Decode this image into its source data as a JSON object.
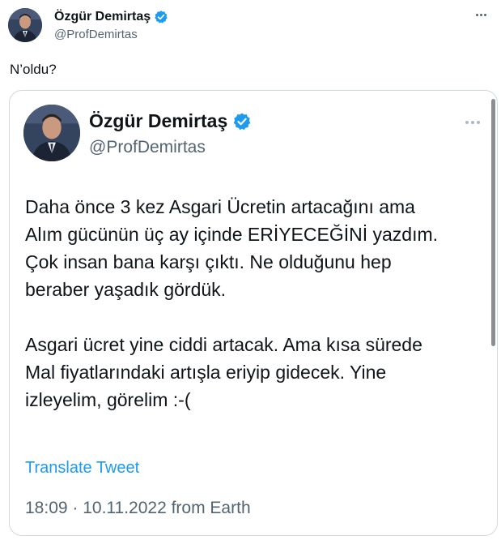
{
  "outer_tweet": {
    "author_name": "Özgür Demirtaş",
    "author_handle": "@ProfDemirtas",
    "text": "N’oldu?"
  },
  "quoted_tweet": {
    "author_name": "Özgür Demirtaş",
    "author_handle": "@ProfDemirtas",
    "paragraphs": [
      [
        "Daha önce 3 kez Asgari Ücretin artacağını ama",
        "Alım gücünün üç ay içinde ERİYECEĞİNİ yazdım.",
        "Çok insan bana karşı çıktı. Ne olduğunu hep",
        "beraber yaşadık gördük."
      ],
      [
        "Asgari ücret yine ciddi artacak. Ama kısa sürede",
        "Mal fiyatlarındaki artışla eriyip gidecek. Yine",
        "izleyelim, görelim :-("
      ]
    ],
    "translate_label": "Translate Tweet",
    "timestamp": "18:09 · 10.11.2022 from Earth"
  },
  "icons": {
    "verified": "verified-badge-icon",
    "more": "more-options-icon"
  },
  "colors": {
    "verified_blue": "#1d9bf0",
    "link_blue": "#1d9bf0",
    "secondary_text": "#536471",
    "primary_text": "#0f1419",
    "border": "#cfd9de"
  }
}
